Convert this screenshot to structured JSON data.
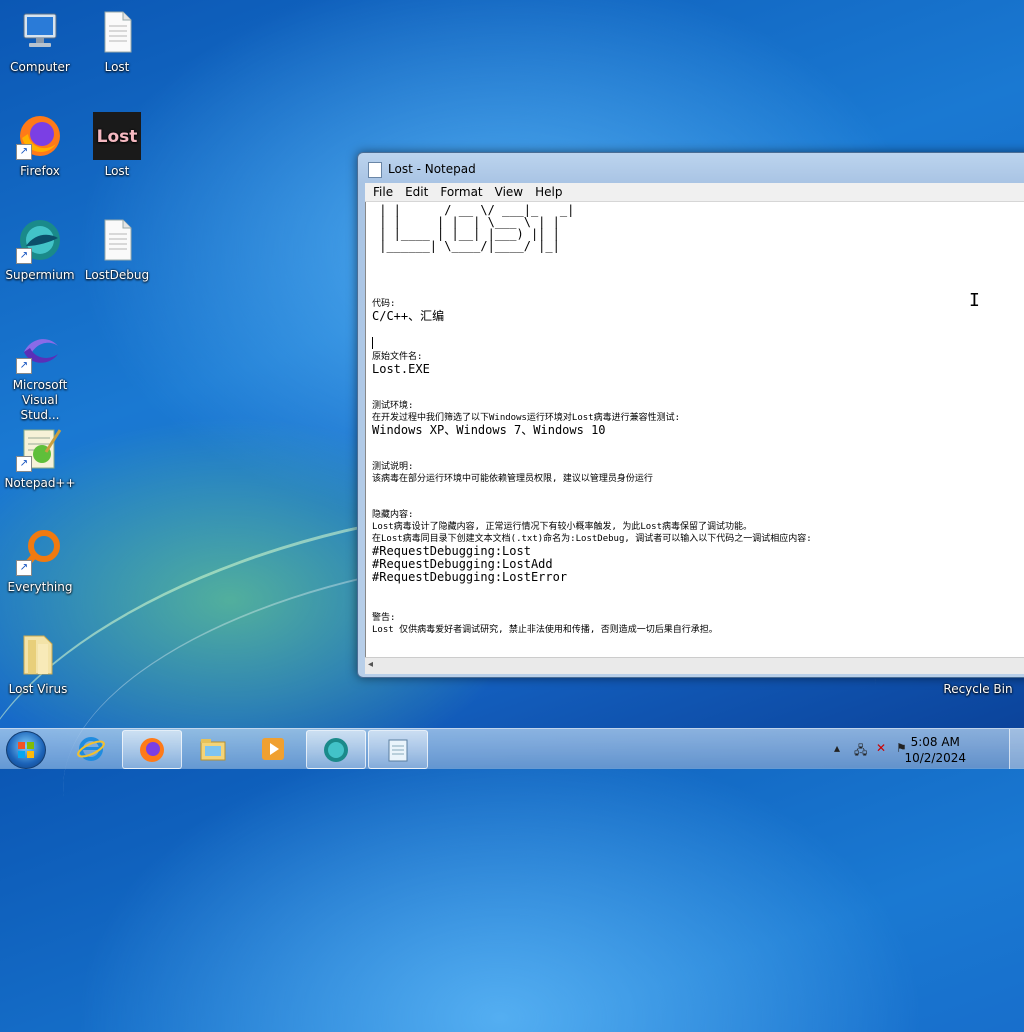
{
  "desktop": {
    "icons": [
      {
        "label": "Computer",
        "icon": "computer-icon"
      },
      {
        "label": "Lost",
        "icon": "text-file-icon"
      },
      {
        "label": "Firefox",
        "icon": "firefox-icon"
      },
      {
        "label": "Lost",
        "icon": "lost-app-icon",
        "logo_text": "Lost"
      },
      {
        "label": "Supermium",
        "icon": "supermium-icon"
      },
      {
        "label": "LostDebug",
        "icon": "text-file-icon"
      },
      {
        "label": "Microsoft Visual Stud...",
        "icon": "visual-studio-icon"
      },
      {
        "label": "Notepad++",
        "icon": "notepadpp-icon"
      },
      {
        "label": "Everything",
        "icon": "everything-icon"
      },
      {
        "label": "Lost Virus",
        "icon": "folder-icon"
      },
      {
        "label": "Recycle Bin",
        "icon": "recycle-bin-icon"
      }
    ]
  },
  "notepad": {
    "title": "Lost - Notepad",
    "menu": [
      "File",
      "Edit",
      "Format",
      "View",
      "Help"
    ],
    "ascii_art": " | |      / __ \\/ ___|_   _|\n | |     | |  | \\___ \\ | |\n | |____ | |__| |___) || |\n |______| \\____/|____/ |_|",
    "sections": {
      "code_label": "代码:",
      "code_value": "C/C++、汇编",
      "orig_label": "原始文件名:",
      "orig_value": "Lost.EXE",
      "env_label": "测试环境:",
      "env_desc": "在开发过程中我们筛选了以下Windows运行环境对Lost病毒进行兼容性测试:",
      "env_value": "Windows XP、Windows 7、Windows 10",
      "note_label": "测试说明:",
      "note_desc": "该病毒在部分运行环境中可能依赖管理员权限, 建议以管理员身份运行",
      "hidden_label": "隐藏内容:",
      "hidden_desc1": "Lost病毒设计了隐藏内容, 正常运行情况下有较小概率触发, 为此Lost病毒保留了调试功能。",
      "hidden_desc2": "在Lost病毒同目录下创建文本文档(.txt)命名为:LostDebug, 调试者可以输入以下代码之一调试相应内容:",
      "cmd1": "#RequestDebugging:Lost",
      "cmd2": "#RequestDebugging:LostAdd",
      "cmd3": "#RequestDebugging:LostError",
      "warn_label": "警告:",
      "warn_desc": "Lost  仅供病毒爱好者调试研究, 禁止非法使用和传播, 否则造成一切后果自行承担。"
    }
  },
  "taskbar": {
    "items": [
      {
        "icon": "internet-explorer-icon",
        "active": false
      },
      {
        "icon": "firefox-icon",
        "active": true
      },
      {
        "icon": "file-explorer-icon",
        "active": false
      },
      {
        "icon": "media-player-icon",
        "active": false
      },
      {
        "icon": "supermium-icon",
        "active": true
      },
      {
        "icon": "notepad-icon",
        "active": true
      }
    ],
    "clock_time": "5:08 AM",
    "clock_date": "10/2/2024"
  },
  "colors": {
    "wallpaper": "#1565c6",
    "window_frame": "#a9c4e4"
  }
}
